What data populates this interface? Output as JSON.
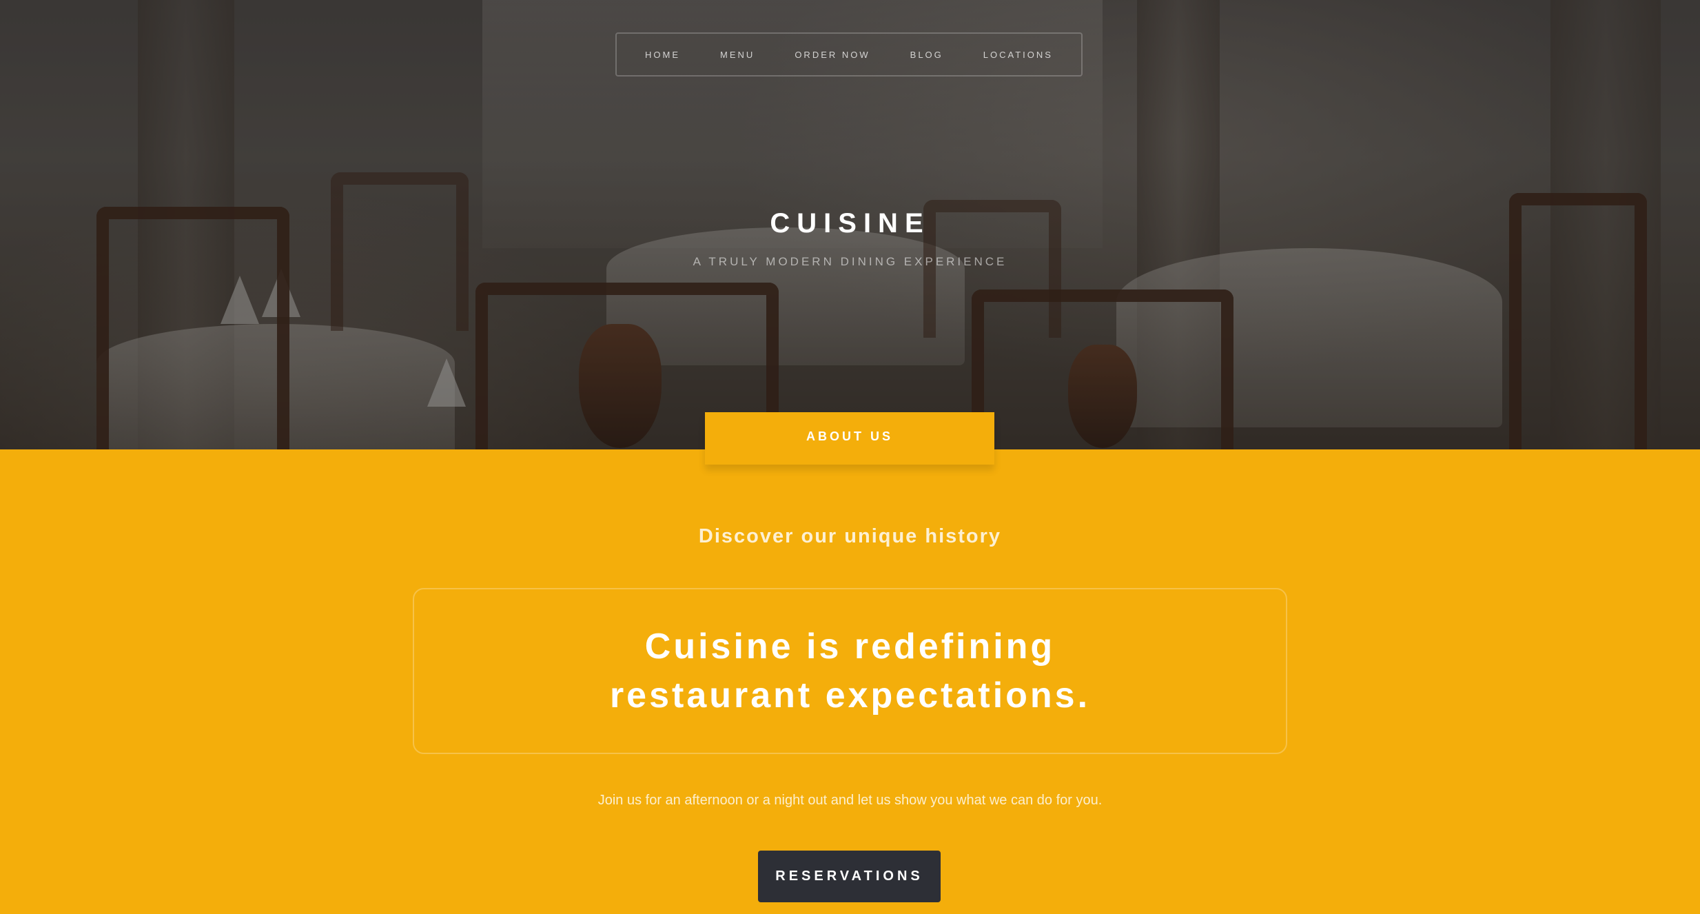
{
  "nav": {
    "items": [
      {
        "label": "HOME"
      },
      {
        "label": "MENU"
      },
      {
        "label": "ORDER NOW"
      },
      {
        "label": "BLOG"
      },
      {
        "label": "LOCATIONS"
      }
    ]
  },
  "hero": {
    "title": "CUISINE",
    "tagline": "A TRULY MODERN DINING EXPERIENCE"
  },
  "about": {
    "tab_label": "ABOUT US",
    "subtitle": "Discover our unique history",
    "quote": "Cuisine is redefining restaurant expectations.",
    "body": "Join us for an afternoon or a night out and let us show you what we can do for you.",
    "button_label": "RESERVATIONS"
  },
  "colors": {
    "accent": "#f4ae0b",
    "button_bg": "#2d2f36",
    "text_light": "#ffffff"
  }
}
